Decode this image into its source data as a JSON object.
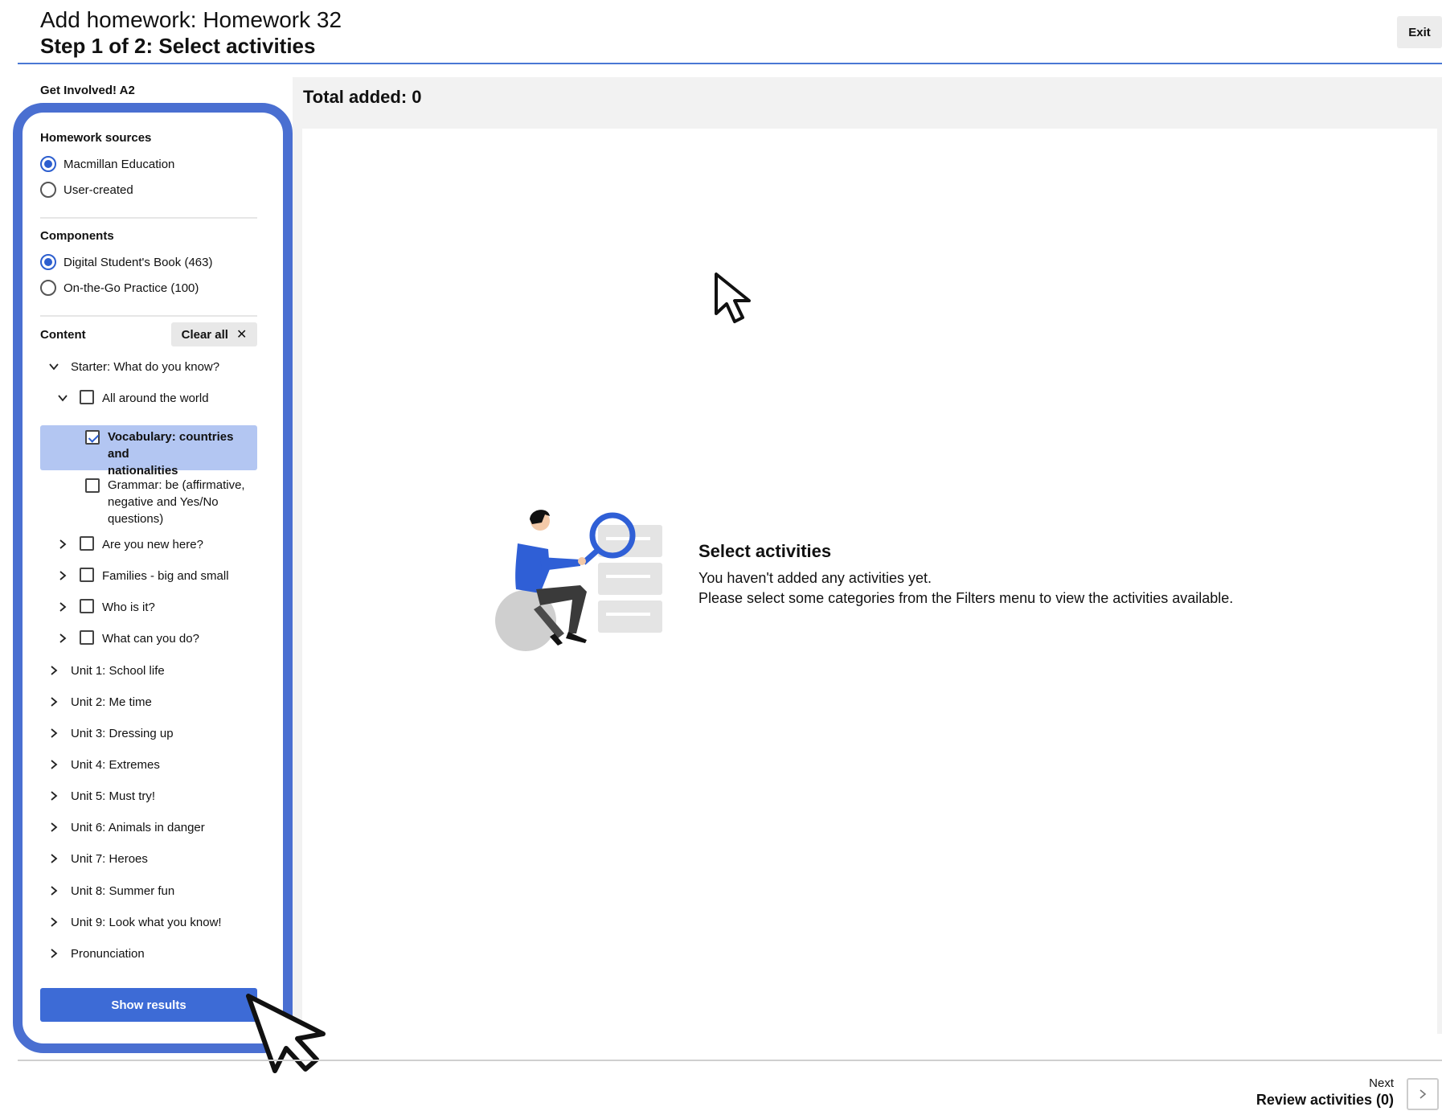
{
  "header": {
    "title": "Add homework: Homework 32",
    "subtitle": "Step 1 of 2: Select activities",
    "exit_label": "Exit"
  },
  "course_label": "Get Involved! A2",
  "sidebar": {
    "sources": {
      "title": "Homework sources",
      "options": [
        {
          "label": "Macmillan Education",
          "selected": true
        },
        {
          "label": "User-created",
          "selected": false
        }
      ]
    },
    "components": {
      "title": "Components",
      "options": [
        {
          "label": "Digital Student's Book (463)",
          "selected": true
        },
        {
          "label": "On-the-Go Practice (100)",
          "selected": false
        }
      ]
    },
    "content": {
      "title": "Content",
      "clear_all_label": "Clear all",
      "tree": [
        {
          "label": "Starter: What do you know?",
          "expanded": true
        },
        {
          "label": "All around the world",
          "expanded": true,
          "checked": false
        },
        {
          "label_lines": [
            "Vocabulary: countries and",
            "nationalities"
          ],
          "checked": true
        },
        {
          "label_lines": [
            "Grammar: be (affirmative,",
            "negative and Yes/No",
            "questions)"
          ],
          "checked": false
        },
        {
          "label": "Are you new here?",
          "checked": false
        },
        {
          "label": "Families - big and small",
          "checked": false
        },
        {
          "label": "Who is it?",
          "checked": false
        },
        {
          "label": "What can you do?",
          "checked": false
        },
        {
          "label": "Unit 1: School life"
        },
        {
          "label": "Unit 2: Me time"
        },
        {
          "label": "Unit 3: Dressing up"
        },
        {
          "label": "Unit 4: Extremes"
        },
        {
          "label": "Unit 5: Must try!"
        },
        {
          "label": "Unit 6: Animals in danger"
        },
        {
          "label": "Unit 7: Heroes"
        },
        {
          "label": "Unit 8: Summer fun"
        },
        {
          "label": "Unit 9: Look what you know!"
        },
        {
          "label": "Pronunciation"
        }
      ]
    },
    "show_results_label": "Show results"
  },
  "main": {
    "total_label": "Total added: 0",
    "empty_state": {
      "title": "Select activities",
      "line1": "You haven't added any activities yet.",
      "line2": "Please select some categories from the Filters menu to view the activities available."
    }
  },
  "footer": {
    "next_label": "Next",
    "review_label": "Review activities (0)"
  },
  "colors": {
    "accent": "#3d6bd6",
    "highlight_frame": "#4a6fd1",
    "selected_row": "#b3c6f2"
  }
}
